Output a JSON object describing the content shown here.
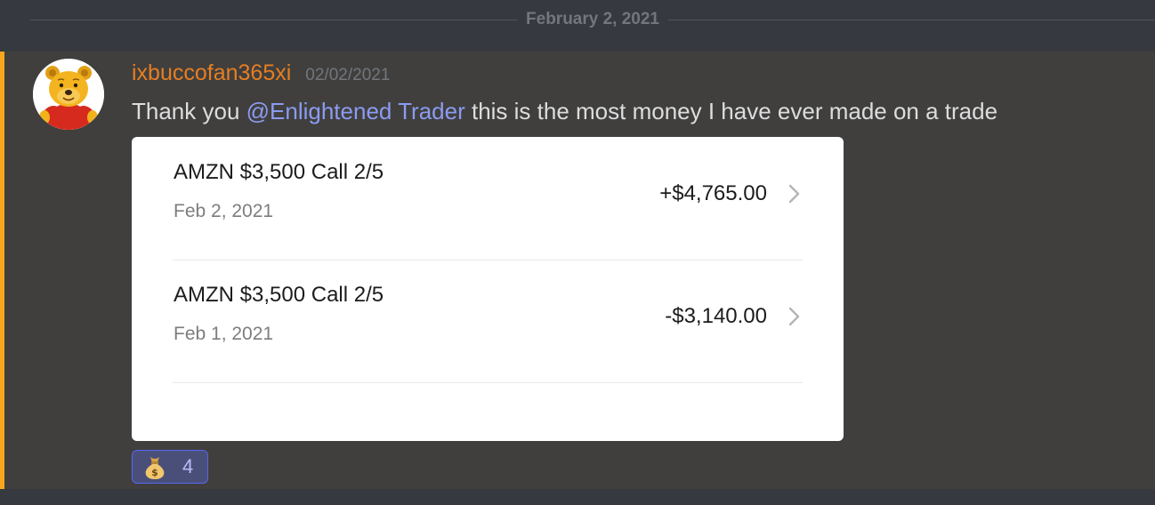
{
  "divider": {
    "date": "February 2, 2021"
  },
  "message": {
    "username": "ixbuccofan365xi",
    "timestamp": "02/02/2021",
    "text_before": "Thank you ",
    "mention": "@Enlightened Trader",
    "text_after": "  this is the most money I have ever made on a trade",
    "avatar_icon": "winnie-the-pooh-avatar",
    "username_color": "#e67e22",
    "mention_color": "#8b9bf2",
    "highlight_bar_color": "#faa61a"
  },
  "attachment": {
    "trades": [
      {
        "title": "AMZN $3,500 Call 2/5",
        "date": "Feb 2, 2021",
        "amount": "+$4,765.00"
      },
      {
        "title": "AMZN $3,500 Call 2/5",
        "date": "Feb 1, 2021",
        "amount": "-$3,140.00"
      }
    ]
  },
  "reaction": {
    "emoji": "money-bag-icon",
    "count": "4"
  }
}
